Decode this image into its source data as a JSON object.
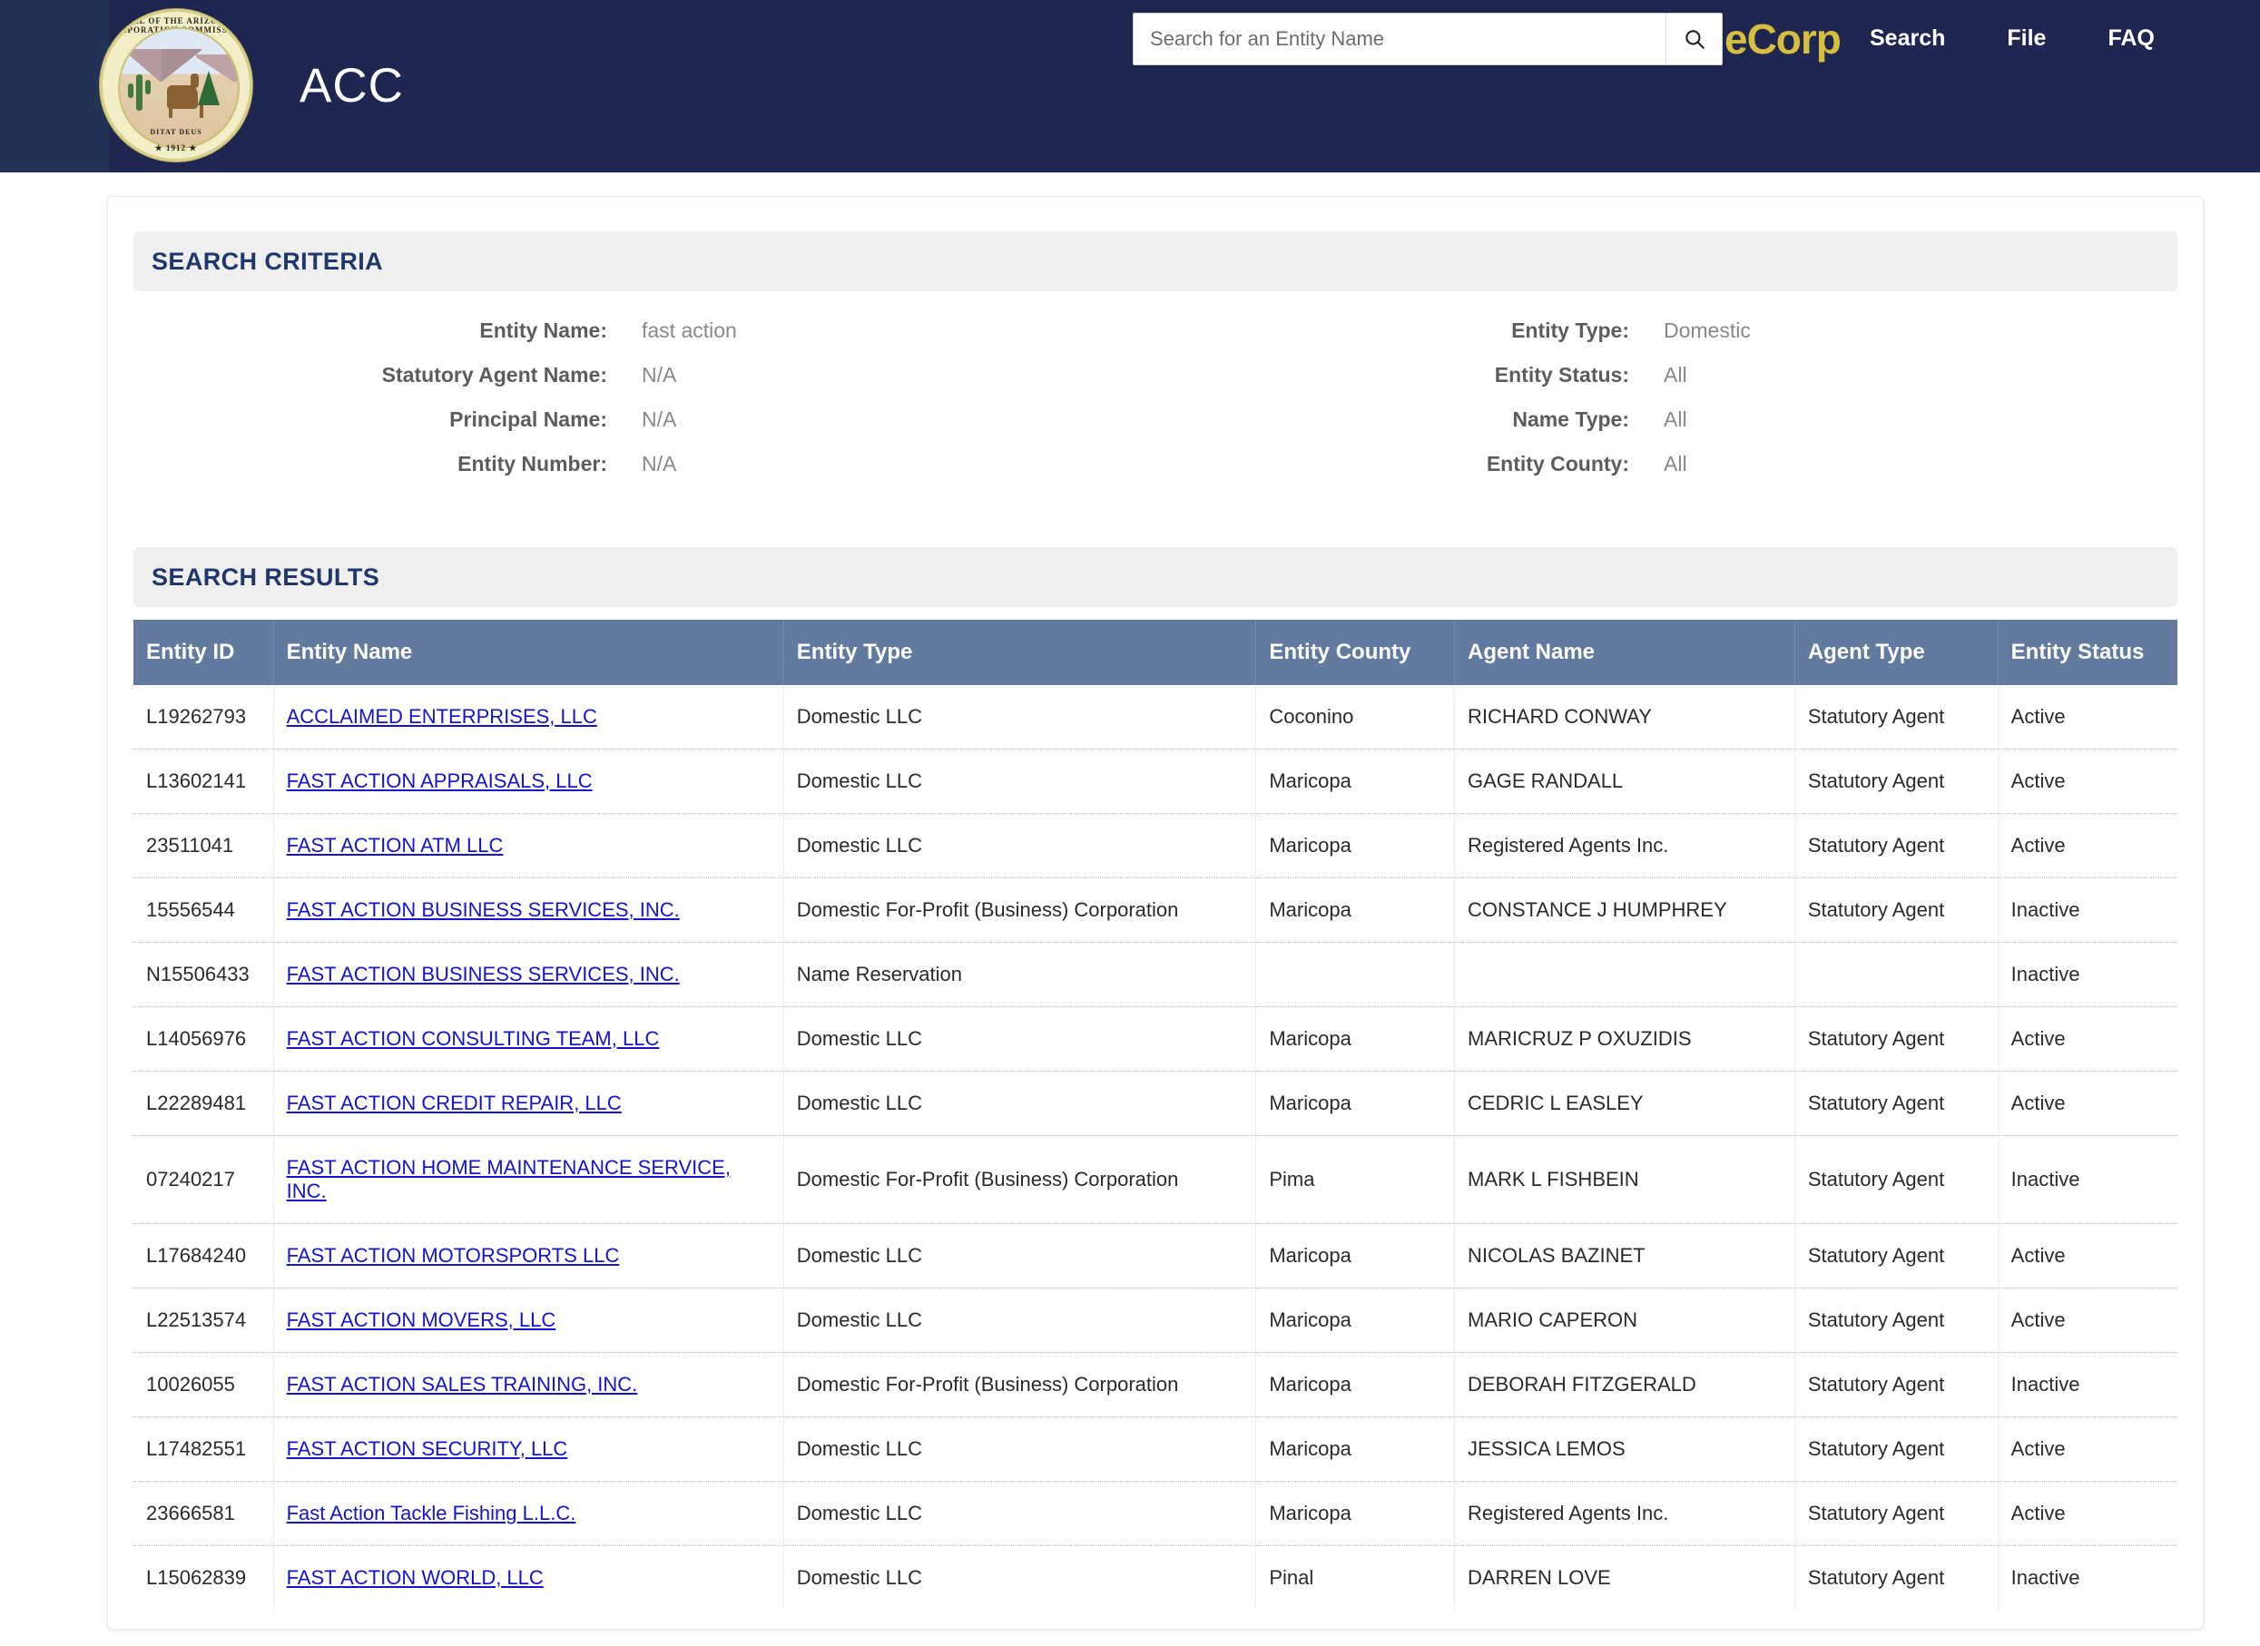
{
  "header": {
    "agency_abbrev": "ACC",
    "seal": {
      "top_text": "SEAL OF THE ARIZONA CORPORATION COMMISSION",
      "motto": "DITAT DEUS",
      "year": "★ 1912 ★"
    },
    "brand": "eCorp",
    "search": {
      "placeholder": "Search for an Entity Name",
      "value": "",
      "button_icon": "search-icon"
    },
    "nav": [
      {
        "label": "Search"
      },
      {
        "label": "File"
      },
      {
        "label": "FAQ"
      }
    ]
  },
  "search_criteria": {
    "title": "SEARCH CRITERIA",
    "left": [
      {
        "label": "Entity Name:",
        "value": "fast action"
      },
      {
        "label": "Statutory Agent Name:",
        "value": "N/A"
      },
      {
        "label": "Principal Name:",
        "value": "N/A"
      },
      {
        "label": "Entity Number:",
        "value": "N/A"
      }
    ],
    "right": [
      {
        "label": "Entity Type:",
        "value": "Domestic"
      },
      {
        "label": "Entity Status:",
        "value": "All"
      },
      {
        "label": "Name Type:",
        "value": "All"
      },
      {
        "label": "Entity County:",
        "value": "All"
      }
    ]
  },
  "search_results": {
    "title": "SEARCH RESULTS",
    "columns": [
      "Entity ID",
      "Entity Name",
      "Entity Type",
      "Entity County",
      "Agent Name",
      "Agent Type",
      "Entity Status"
    ],
    "rows": [
      {
        "entity_id": "L19262793",
        "entity_name": "ACCLAIMED ENTERPRISES, LLC",
        "entity_type": "Domestic LLC",
        "entity_county": "Coconino",
        "agent_name": "RICHARD CONWAY",
        "agent_type": "Statutory Agent",
        "entity_status": "Active"
      },
      {
        "entity_id": "L13602141",
        "entity_name": "FAST ACTION APPRAISALS, LLC",
        "entity_type": "Domestic LLC",
        "entity_county": "Maricopa",
        "agent_name": "GAGE RANDALL",
        "agent_type": "Statutory Agent",
        "entity_status": "Active"
      },
      {
        "entity_id": "23511041",
        "entity_name": "FAST ACTION ATM LLC",
        "entity_type": "Domestic LLC",
        "entity_county": "Maricopa",
        "agent_name": "Registered Agents Inc.",
        "agent_type": "Statutory Agent",
        "entity_status": "Active"
      },
      {
        "entity_id": "15556544",
        "entity_name": "FAST ACTION BUSINESS SERVICES, INC.",
        "entity_type": "Domestic For-Profit (Business) Corporation",
        "entity_county": "Maricopa",
        "agent_name": "CONSTANCE J HUMPHREY",
        "agent_type": "Statutory Agent",
        "entity_status": "Inactive"
      },
      {
        "entity_id": "N15506433",
        "entity_name": "FAST ACTION BUSINESS SERVICES, INC.",
        "entity_type": "Name Reservation",
        "entity_county": "",
        "agent_name": "",
        "agent_type": "",
        "entity_status": "Inactive"
      },
      {
        "entity_id": "L14056976",
        "entity_name": "FAST ACTION CONSULTING TEAM, LLC",
        "entity_type": "Domestic LLC",
        "entity_county": "Maricopa",
        "agent_name": "MARICRUZ P OXUZIDIS",
        "agent_type": "Statutory Agent",
        "entity_status": "Active"
      },
      {
        "entity_id": "L22289481",
        "entity_name": "FAST ACTION CREDIT REPAIR, LLC",
        "entity_type": "Domestic LLC",
        "entity_county": "Maricopa",
        "agent_name": "CEDRIC L EASLEY",
        "agent_type": "Statutory Agent",
        "entity_status": "Active"
      },
      {
        "entity_id": "07240217",
        "entity_name": "FAST ACTION HOME MAINTENANCE SERVICE, INC.",
        "entity_type": "Domestic For-Profit (Business) Corporation",
        "entity_county": "Pima",
        "agent_name": "MARK L FISHBEIN",
        "agent_type": "Statutory Agent",
        "entity_status": "Inactive"
      },
      {
        "entity_id": "L17684240",
        "entity_name": "FAST ACTION MOTORSPORTS LLC",
        "entity_type": "Domestic LLC",
        "entity_county": "Maricopa",
        "agent_name": "NICOLAS BAZINET",
        "agent_type": "Statutory Agent",
        "entity_status": "Active"
      },
      {
        "entity_id": "L22513574",
        "entity_name": "FAST ACTION MOVERS, LLC",
        "entity_type": "Domestic LLC",
        "entity_county": "Maricopa",
        "agent_name": "MARIO CAPERON",
        "agent_type": "Statutory Agent",
        "entity_status": "Active"
      },
      {
        "entity_id": "10026055",
        "entity_name": "FAST ACTION SALES TRAINING, INC.",
        "entity_type": "Domestic For-Profit (Business) Corporation",
        "entity_county": "Maricopa",
        "agent_name": "DEBORAH FITZGERALD",
        "agent_type": "Statutory Agent",
        "entity_status": "Inactive"
      },
      {
        "entity_id": "L17482551",
        "entity_name": "FAST ACTION SECURITY, LLC",
        "entity_type": "Domestic LLC",
        "entity_county": "Maricopa",
        "agent_name": "JESSICA LEMOS",
        "agent_type": "Statutory Agent",
        "entity_status": "Active"
      },
      {
        "entity_id": "23666581",
        "entity_name": "Fast Action Tackle Fishing L.L.C.",
        "entity_type": "Domestic LLC",
        "entity_county": "Maricopa",
        "agent_name": "Registered Agents Inc.",
        "agent_type": "Statutory Agent",
        "entity_status": "Active"
      },
      {
        "entity_id": "L15062839",
        "entity_name": "FAST ACTION WORLD, LLC",
        "entity_type": "Domestic LLC",
        "entity_county": "Pinal",
        "agent_name": "DARREN LOVE",
        "agent_type": "Statutory Agent",
        "entity_status": "Inactive"
      }
    ]
  },
  "colors": {
    "header_navy": "#1f2751",
    "header_navy_light": "#233356",
    "brand_gold": "#d6bf3e",
    "table_header": "#617a9e",
    "section_title": "#20376b",
    "link_blue": "#1414cc",
    "section_bar_bg": "#efefef"
  }
}
